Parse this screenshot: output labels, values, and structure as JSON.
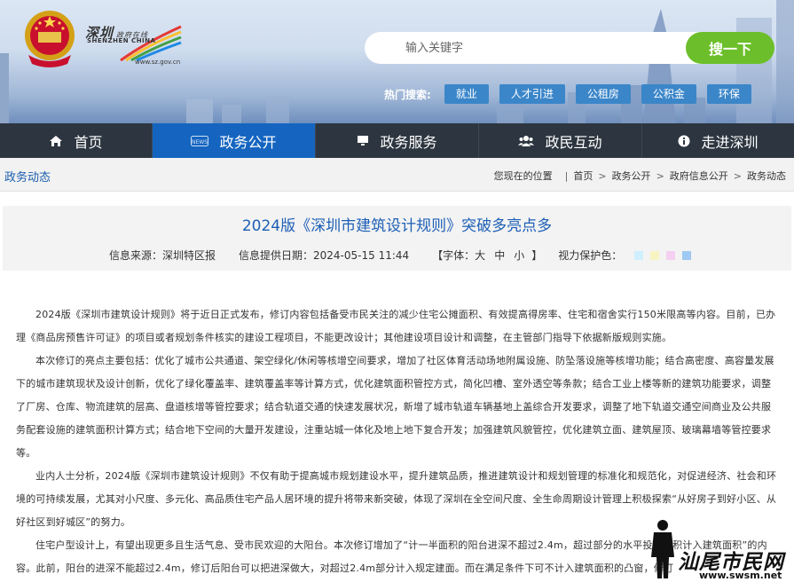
{
  "header": {
    "logo_cn": "深圳",
    "logo_cn_small": "政府在线",
    "logo_en": "SHENZHEN CHINA",
    "logo_url": "www.sz.gov.cn",
    "search_placeholder": "输入关键字",
    "search_button": "搜一下",
    "hot_label": "热门搜索:",
    "hot_tags": [
      "就业",
      "人才引进",
      "公租房",
      "公积金",
      "环保"
    ]
  },
  "nav": [
    {
      "label": "首页",
      "icon": "home-icon"
    },
    {
      "label": "政务公开",
      "icon": "news-icon",
      "active": true
    },
    {
      "label": "政务服务",
      "icon": "monitor-icon"
    },
    {
      "label": "政民互动",
      "icon": "users-icon"
    },
    {
      "label": "走进深圳",
      "icon": "info-circle-icon"
    }
  ],
  "breadcrumb": {
    "section": "政务动态",
    "location_label": "您现在的位置",
    "items": [
      "首页",
      "政务公开",
      "政府信息公开",
      "政务动态"
    ]
  },
  "article": {
    "title": "2024版《深圳市建筑设计规则》突破多亮点多",
    "source": "信息来源：深圳特区报",
    "date": "信息提供日期：2024-05-15 11:44",
    "fontsize_label": "【字体：",
    "fontsize_options": [
      "大",
      "中",
      "小"
    ],
    "fontsize_close": "】",
    "eye_label": "视力保护色：",
    "eye_colors": [
      "#cfefff",
      "#f8f4c2",
      "#f5d0f2",
      "#9ec9f2"
    ],
    "paragraphs": [
      "2024版《深圳市建筑设计规则》将于近日正式发布，修订内容包括备受市民关注的减少住宅公摊面积、有效提高得房率、住宅和宿舍实行150米限高等内容。目前，已办理《商品房预售许可证》的项目或者规划条件核实的建设工程项目，不能更改设计；其他建设项目设计和调整，在主管部门指导下依据新版规则实施。",
      "本次修订的亮点主要包括：优化了城市公共通道、架空绿化/休闲等核增空间要求，增加了社区体育活动场地附属设施、防坠落设施等核增功能；结合高密度、高容量发展下的城市建筑现状及设计创新，优化了绿化覆盖率、建筑覆盖率等计算方式，优化建筑面积管控方式，简化凹槽、室外透空等条款；结合工业上楼等新的建筑功能要求，调整了厂房、仓库、物流建筑的层高、盘道核增等管控要求；结合轨道交通的快速发展状况，新增了城市轨道车辆基地上盖综合开发要求，调整了地下轨道交通空间商业及公共服务配套设施的建筑面积计算方式；结合地下空间的大量开发建设，注重站城一体化及地上地下复合开发；加强建筑风貌管控，优化建筑立面、建筑屋顶、玻璃幕墙等管控要求等。",
      "业内人士分析，2024版《深圳市建筑设计规则》不仅有助于提高城市规划建设水平，提升建筑品质，推进建筑设计和规划管理的标准化和规范化，对促进经济、社会和环境的可持续发展，尤其对小尺度、多元化、高品质住宅产品人居环境的提升将带来新突破，体现了深圳在全空间尺度、全生命周期设计管理上积极探索“从好房子到好小区、从好社区到好城区”的努力。",
      "住宅户型设计上，有望出现更多且生活气息、受市民欢迎的大阳台。本次修订增加了“计一半面积的阳台进深不超过2.4m，超过部分的水平投影面积计入建筑面积”的内容。此前，阳台的进深不能超过2.4m，修订后阳台可以把进深做大，对超过2.4m部分计入规定建面。而在满足条件下可不计入建筑面积的凸窗，修订"
    ]
  },
  "watermark": {
    "text": "汕尾市民网",
    "url": "www.swsm.net"
  }
}
